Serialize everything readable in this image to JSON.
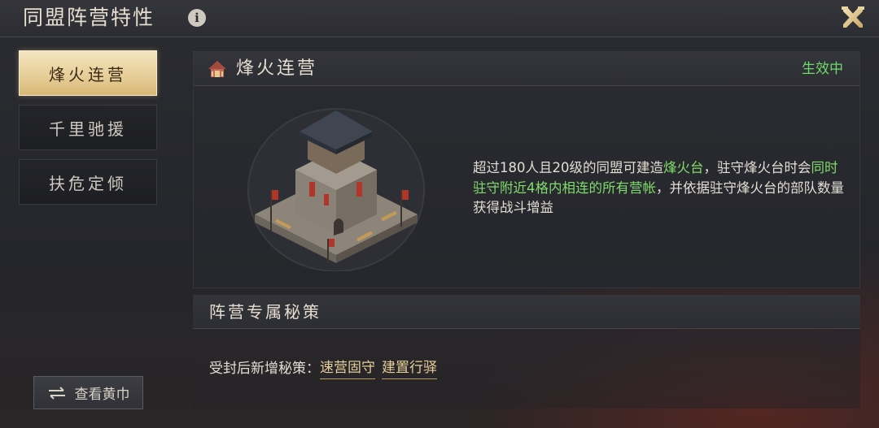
{
  "header": {
    "title": "同盟阵营特性",
    "info_icon": "i"
  },
  "sidebar": {
    "items": [
      {
        "label": "烽火连营",
        "active": true
      },
      {
        "label": "千里驰援",
        "active": false
      },
      {
        "label": "扶危定倾",
        "active": false
      }
    ],
    "yellow_scarf_button": "查看黄巾"
  },
  "feature": {
    "title": "烽火连营",
    "status": "生效中",
    "description": {
      "part1": "超过180人且20级的同盟可建造",
      "highlight1": "烽火台",
      "part2": "，驻守烽火台时会",
      "highlight2": "同时驻守附近4格内相连的所有营帐",
      "part3": "，并依据驻守烽火台的部队数量获得战斗增益"
    }
  },
  "strategy": {
    "title": "阵营专属秘策",
    "label": "受封后新增秘策：",
    "links": [
      "速营固守",
      "建置行驿"
    ]
  },
  "colors": {
    "active_tab": "#e7cf9a",
    "status_green": "#6ed96a",
    "highlight_green": "#7fdc6a",
    "link_gold": "#e6cf98"
  }
}
